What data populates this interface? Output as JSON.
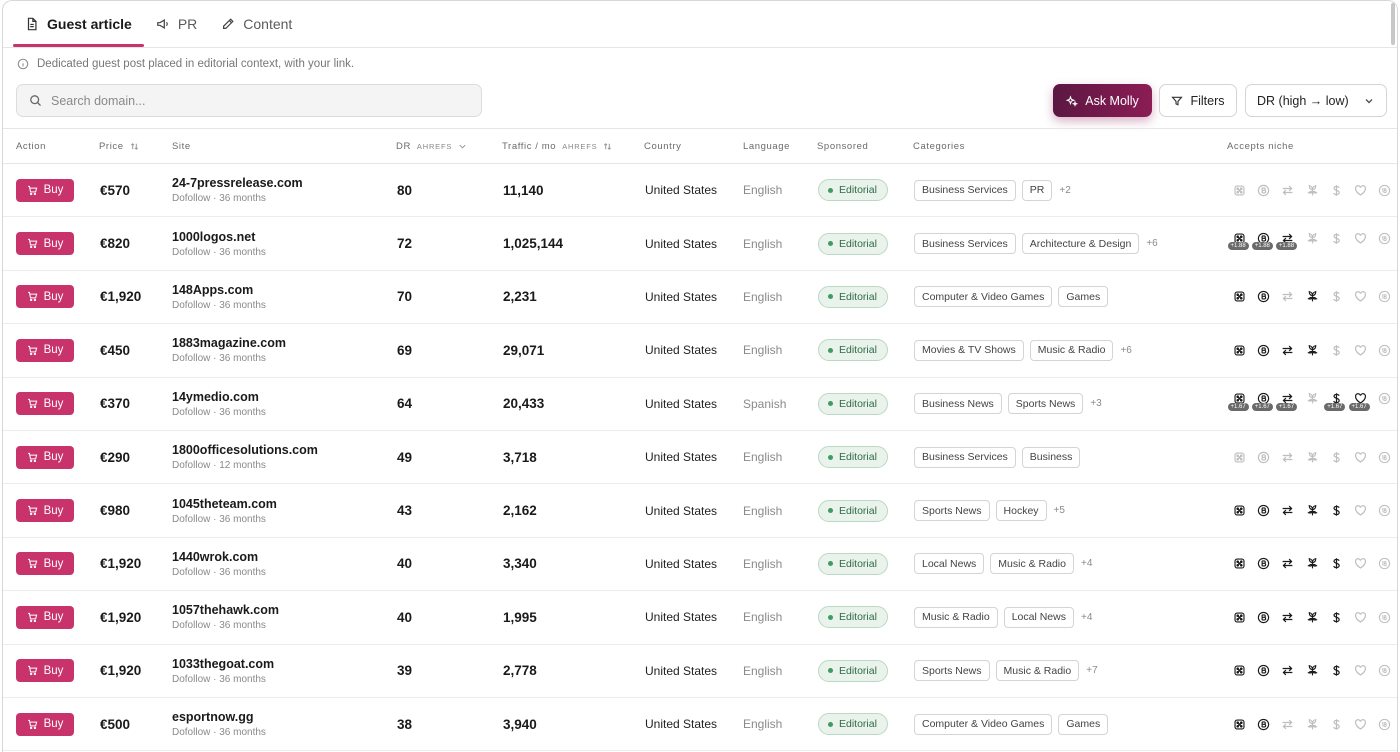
{
  "tabs": [
    {
      "label": "Guest article",
      "icon": "document-icon",
      "active": true
    },
    {
      "label": "PR",
      "icon": "megaphone-icon",
      "active": false
    },
    {
      "label": "Content",
      "icon": "pencil-icon",
      "active": false
    }
  ],
  "info_text": "Dedicated guest post placed in editorial context, with your link.",
  "search": {
    "placeholder": "Search domain..."
  },
  "toolbar": {
    "ask_label": "Ask Molly",
    "filters_label": "Filters",
    "sort_value": "DR (high → low)"
  },
  "columns": {
    "action": "Action",
    "price": "Price",
    "site": "Site",
    "dr": "DR",
    "dr_sub": "AHREFS",
    "traffic": "Traffic / mo",
    "traffic_sub": "AHREFS",
    "country": "Country",
    "language": "Language",
    "sponsored": "Sponsored",
    "categories": "Categories",
    "niche": "Accepts niche"
  },
  "buy_label": "Buy",
  "niche_icons": [
    "casino-icon",
    "crypto-icon",
    "forex-icon",
    "cbd-icon",
    "finance-icon",
    "dating-icon",
    "adult-icon"
  ],
  "colors": {
    "accent": "#c7336a",
    "ask_gradient_start": "#5b1742",
    "ask_gradient_end": "#8c1c55",
    "badge_green": "#2f6b44"
  },
  "rows": [
    {
      "price": "€570",
      "site": "24-7pressrelease.com",
      "meta": "Dofollow · 36 months",
      "dr": "80",
      "traffic": "11,140",
      "country": "United States",
      "language": "English",
      "sponsored": "Editorial",
      "categories": [
        "Business Services",
        "PR"
      ],
      "more": "+2",
      "niche": [
        0,
        0,
        0,
        0,
        0,
        0,
        0
      ],
      "mult": [
        "",
        "",
        "",
        "",
        "",
        "",
        ""
      ]
    },
    {
      "price": "€820",
      "site": "1000logos.net",
      "meta": "Dofollow · 36 months",
      "dr": "72",
      "traffic": "1,025,144",
      "country": "United States",
      "language": "English",
      "sponsored": "Editorial",
      "categories": [
        "Business Services",
        "Architecture & Design"
      ],
      "more": "+6",
      "niche": [
        1,
        1,
        1,
        0,
        0,
        0,
        0
      ],
      "mult": [
        "+1.88",
        "+1.88",
        "+1.88",
        "",
        "",
        "",
        ""
      ]
    },
    {
      "price": "€1,920",
      "site": "148Apps.com",
      "meta": "Dofollow · 36 months",
      "dr": "70",
      "traffic": "2,231",
      "country": "United States",
      "language": "English",
      "sponsored": "Editorial",
      "categories": [
        "Computer & Video Games",
        "Games"
      ],
      "more": "",
      "niche": [
        1,
        1,
        0,
        1,
        0,
        0,
        0
      ],
      "mult": [
        "",
        "",
        "",
        "",
        "",
        "",
        ""
      ]
    },
    {
      "price": "€450",
      "site": "1883magazine.com",
      "meta": "Dofollow · 36 months",
      "dr": "69",
      "traffic": "29,071",
      "country": "United States",
      "language": "English",
      "sponsored": "Editorial",
      "categories": [
        "Movies & TV Shows",
        "Music & Radio"
      ],
      "more": "+6",
      "niche": [
        1,
        1,
        1,
        1,
        0,
        0,
        0
      ],
      "mult": [
        "",
        "",
        "",
        "",
        "",
        "",
        ""
      ]
    },
    {
      "price": "€370",
      "site": "14ymedio.com",
      "meta": "Dofollow · 36 months",
      "dr": "64",
      "traffic": "20,433",
      "country": "United States",
      "language": "Spanish",
      "sponsored": "Editorial",
      "categories": [
        "Business News",
        "Sports News"
      ],
      "more": "+3",
      "niche": [
        1,
        1,
        1,
        0,
        1,
        1,
        0
      ],
      "mult": [
        "+1.67",
        "+1.67",
        "+1.67",
        "",
        "+1.67",
        "+1.67",
        ""
      ]
    },
    {
      "price": "€290",
      "site": "1800officesolutions.com",
      "meta": "Dofollow · 12 months",
      "dr": "49",
      "traffic": "3,718",
      "country": "United States",
      "language": "English",
      "sponsored": "Editorial",
      "categories": [
        "Business Services",
        "Business"
      ],
      "more": "",
      "niche": [
        0,
        0,
        0,
        0,
        0,
        0,
        0
      ],
      "mult": [
        "",
        "",
        "",
        "",
        "",
        "",
        ""
      ]
    },
    {
      "price": "€980",
      "site": "1045theteam.com",
      "meta": "Dofollow · 36 months",
      "dr": "43",
      "traffic": "2,162",
      "country": "United States",
      "language": "English",
      "sponsored": "Editorial",
      "categories": [
        "Sports News",
        "Hockey"
      ],
      "more": "+5",
      "niche": [
        1,
        1,
        1,
        1,
        1,
        0,
        0
      ],
      "mult": [
        "",
        "",
        "",
        "",
        "",
        "",
        ""
      ]
    },
    {
      "price": "€1,920",
      "site": "1440wrok.com",
      "meta": "Dofollow · 36 months",
      "dr": "40",
      "traffic": "3,340",
      "country": "United States",
      "language": "English",
      "sponsored": "Editorial",
      "categories": [
        "Local News",
        "Music & Radio"
      ],
      "more": "+4",
      "niche": [
        1,
        1,
        1,
        1,
        1,
        0,
        0
      ],
      "mult": [
        "",
        "",
        "",
        "",
        "",
        "",
        ""
      ]
    },
    {
      "price": "€1,920",
      "site": "1057thehawk.com",
      "meta": "Dofollow · 36 months",
      "dr": "40",
      "traffic": "1,995",
      "country": "United States",
      "language": "English",
      "sponsored": "Editorial",
      "categories": [
        "Music & Radio",
        "Local News"
      ],
      "more": "+4",
      "niche": [
        1,
        1,
        1,
        1,
        1,
        0,
        0
      ],
      "mult": [
        "",
        "",
        "",
        "",
        "",
        "",
        ""
      ]
    },
    {
      "price": "€1,920",
      "site": "1033thegoat.com",
      "meta": "Dofollow · 36 months",
      "dr": "39",
      "traffic": "2,778",
      "country": "United States",
      "language": "English",
      "sponsored": "Editorial",
      "categories": [
        "Sports News",
        "Music & Radio"
      ],
      "more": "+7",
      "niche": [
        1,
        1,
        1,
        1,
        1,
        0,
        0
      ],
      "mult": [
        "",
        "",
        "",
        "",
        "",
        "",
        ""
      ]
    },
    {
      "price": "€500",
      "site": "esportnow.gg",
      "meta": "Dofollow · 36 months",
      "dr": "38",
      "traffic": "3,940",
      "country": "United States",
      "language": "English",
      "sponsored": "Editorial",
      "categories": [
        "Computer & Video Games",
        "Games"
      ],
      "more": "",
      "niche": [
        1,
        1,
        0,
        0,
        0,
        0,
        0
      ],
      "mult": [
        "",
        "",
        "",
        "",
        "",
        "",
        ""
      ]
    }
  ]
}
